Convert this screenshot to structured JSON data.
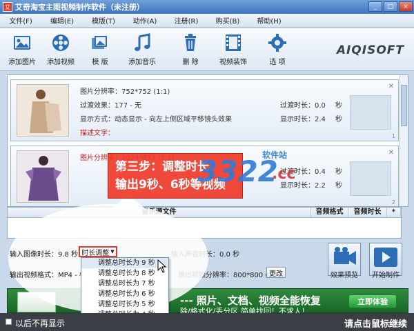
{
  "window": {
    "title": "艾奇淘宝主图视频制作软件（未注册）",
    "buttons": [
      "_",
      "□",
      "×"
    ]
  },
  "menu": [
    "文件(F)",
    "编辑(E)",
    "模版(T)",
    "动作(A)",
    "注册(R)",
    "购买(B)",
    "帮助(H)"
  ],
  "toolbar": {
    "items": [
      {
        "label": "添加图片",
        "icon": "image-icon"
      },
      {
        "label": "添加视频",
        "icon": "film-reel-icon"
      },
      {
        "label": "模 版",
        "icon": "template-icon"
      },
      {
        "label": "添加音乐",
        "icon": "music-note-icon"
      },
      {
        "label": "删 除",
        "icon": "trash-icon"
      },
      {
        "label": "视频装饰",
        "icon": "film-strip-icon"
      },
      {
        "label": "选 项",
        "icon": "gear-icon"
      }
    ],
    "brand": "AIQISOFT"
  },
  "items": [
    {
      "resolution": "图片分辨率：752*752 (1:1)",
      "transition": "过渡效果：177 - 无",
      "display_mode": "显示方式：动态显示 - 向左上侧区域平移镜头效果",
      "caption": "描述文字：",
      "transition_time_label": "过渡时长：0.0",
      "transition_time_unit": "秒",
      "display_time_label": "显示时长：2.4",
      "display_time_unit": "秒",
      "index": "1"
    },
    {
      "resolution": "图片分辨率：1024*837 (1:1)",
      "transition_time_label": "过渡时长：0.4",
      "transition_time_unit": "秒",
      "display_time_label": "显示时长：2.2",
      "display_time_unit": "秒",
      "index": "2"
    }
  ],
  "music_table": {
    "columns": [
      "音乐源文件",
      "音频格式",
      "音频时长",
      "*"
    ]
  },
  "bottom": {
    "image_duration": "输入图像时长：9.8 秒",
    "duration_adjust_btn": "时长调整",
    "audio_duration": "输入声音时长：0.0 秒",
    "output_format": "输出视频格式：MP4 - 标",
    "output_resolution": "输出视频分辨率：800*800 (1:1)",
    "change_btn": "更改",
    "preview_btn": "效果预览",
    "start_btn": "开始制作"
  },
  "dropdown": {
    "options": [
      "调整总时长为 9 秒",
      "调整总时长为 8 秒",
      "调整总时长为 7 秒",
      "调整总时长为 6 秒",
      "调整总时长为 5 秒",
      "调整总时长为 4 秒"
    ]
  },
  "callout": {
    "line1": "第三步：调整时长",
    "line2": "输出9秒、6秒等视频"
  },
  "watermark": {
    "number": "3322",
    "suffix": ".cc",
    "text": "软件站"
  },
  "banner": {
    "title": "--- 照片、文档、视频全能恢复",
    "subtitle": "除/格式化/丢分区   简单找回！不求人！",
    "cta": "立即体验"
  },
  "status": {
    "left": "以后不再显示",
    "right": "请点击鼠标继续"
  },
  "colors": {
    "accent": "#3d74bd",
    "callout": "#f03626",
    "banner": "#2f8a3c"
  }
}
